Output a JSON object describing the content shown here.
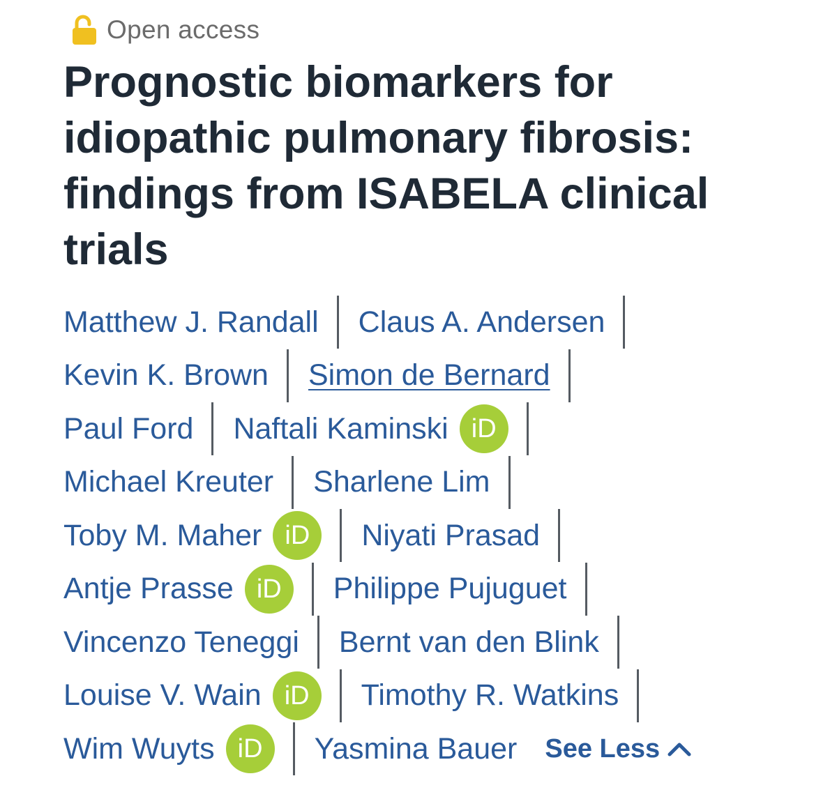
{
  "access": {
    "icon": "open-lock-icon",
    "label": "Open access",
    "icon_color": "#f0c020"
  },
  "article": {
    "title": "Prognostic biomarkers for idiopathic pulmonary fibrosis: findings from ISABELA clinical trials"
  },
  "authors": {
    "rows": [
      [
        {
          "name": "Matthew J. Randall"
        },
        {
          "name": "Claus A. Andersen"
        }
      ],
      [
        {
          "name": "Kevin K. Brown"
        },
        {
          "name": "Simon de Bernard"
        }
      ],
      [
        {
          "name": "Paul Ford"
        },
        {
          "name": "Naftali Kaminski",
          "orcid": "iD"
        }
      ],
      [
        {
          "name": "Michael Kreuter"
        },
        {
          "name": "Sharlene Lim"
        }
      ],
      [
        {
          "name": "Toby M. Maher",
          "orcid": "iD"
        },
        {
          "name": "Niyati Prasad"
        }
      ],
      [
        {
          "name": "Antje Prasse",
          "orcid": "iD"
        },
        {
          "name": "Philippe Pujuguet"
        }
      ],
      [
        {
          "name": "Vincenzo Teneggi"
        },
        {
          "name": "Bernt van den Blink"
        }
      ],
      [
        {
          "name": "Louise V. Wain",
          "orcid": "iD"
        },
        {
          "name": "Timothy R. Watkins"
        }
      ],
      [
        {
          "name": "Wim Wuyts",
          "orcid": "iD"
        },
        {
          "name": "Yasmina Bauer"
        }
      ]
    ],
    "see_less_label": "See Less",
    "see_less_icon": "chevron-up-icon",
    "orcid_color": "#a6ce39",
    "link_color": "#2a5a9a"
  }
}
